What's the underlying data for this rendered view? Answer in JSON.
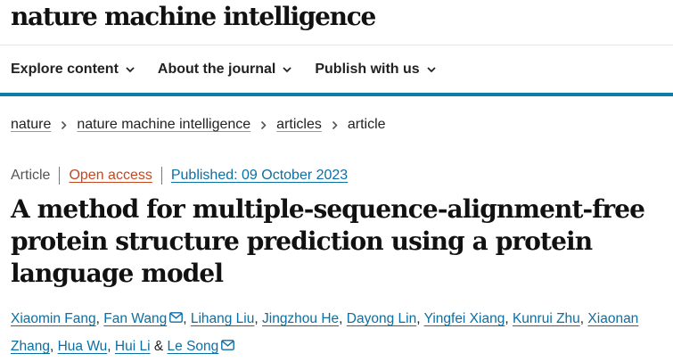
{
  "site": {
    "logo_text": "nature machine intelligence"
  },
  "nav": {
    "items": [
      {
        "label": "Explore content"
      },
      {
        "label": "About the journal"
      },
      {
        "label": "Publish with us"
      }
    ]
  },
  "breadcrumb": {
    "items": [
      "nature",
      "nature machine intelligence",
      "articles"
    ],
    "current": "article"
  },
  "article": {
    "type": "Article",
    "access": "Open access",
    "published": "Published: 09 October 2023",
    "title": "A method for multiple-sequence-alignment-free protein structure prediction using a protein language model",
    "authors": [
      {
        "name": "Xiaomin Fang"
      },
      {
        "name": "Fan Wang",
        "icon": "envelope-icon"
      },
      {
        "name": "Lihang Liu"
      },
      {
        "name": "Jingzhou He"
      },
      {
        "name": "Dayong Lin"
      },
      {
        "name": "Yingfei Xiang"
      },
      {
        "name": "Kunrui Zhu"
      },
      {
        "name": "Xiaonan Zhang"
      },
      {
        "name": "Hua Wu"
      },
      {
        "name": "Hui Li"
      },
      {
        "name": "Le Song",
        "icon": "envelope-icon"
      }
    ],
    "separators": {
      "comma": ",",
      "and": "&"
    }
  },
  "colors": {
    "accent_bar": "#0c7da7",
    "link": "#0c6fa3",
    "open_access": "#c5471f"
  }
}
